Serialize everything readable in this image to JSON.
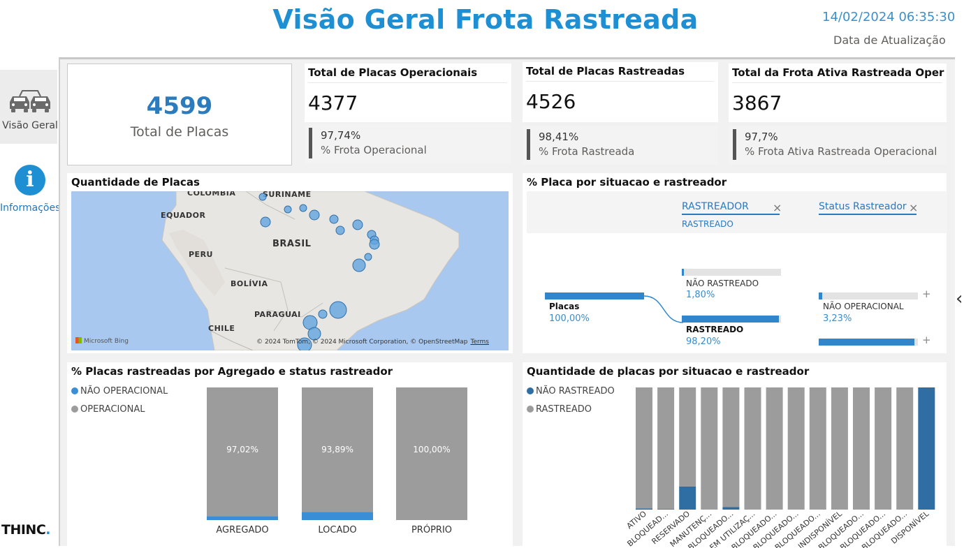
{
  "header": {
    "title": "Visão Geral Frota Rastreada",
    "update_datetime": "14/02/2024 06:35:30",
    "update_label": "Data de Atualização"
  },
  "sidebar": {
    "items": [
      {
        "label": "Visão Geral",
        "icon": "cars-icon",
        "active": true
      },
      {
        "label": "Informações",
        "icon": "info-icon",
        "active": false
      }
    ],
    "brand": "THINC."
  },
  "kpis": {
    "total": {
      "value": "4599",
      "label": "Total de Placas"
    },
    "operacionais": {
      "title": "Total de Placas Operacionais",
      "value": "4377",
      "pct": "97,74%",
      "pct_label": "% Frota Operacional"
    },
    "rastreadas": {
      "title": "Total de Placas Rastreadas",
      "value": "4526",
      "pct": "98,41%",
      "pct_label": "% Frota Rastreada"
    },
    "ativa": {
      "title": "Total da Frota Ativa Rastreada Operaci...",
      "value": "3867",
      "pct": "97,7%",
      "pct_label": "% Frota Ativa Rastreada Operacional"
    }
  },
  "map": {
    "title": "Quantidade de Placas",
    "labels": [
      "COLÔMBIA",
      "SURINAME",
      "EQUADOR",
      "BRASIL",
      "PERU",
      "BOLÍVIA",
      "PARAGUAI",
      "CHILE"
    ],
    "bing": "Microsoft Bing",
    "credit": "© 2024 TomTom, © 2024 Microsoft Corporation, © OpenStreetMap",
    "terms": "Terms"
  },
  "decomp": {
    "title": "% Placa por situacao e rastreador",
    "col1": "RASTREADOR",
    "col1_sub": "RASTREADO",
    "col2": "Status Rastreador",
    "root": {
      "label": "Placas",
      "value": "100,00%"
    },
    "level1": [
      {
        "label": "NÃO RASTREADO",
        "value": "1,80%",
        "pct": 1.8
      },
      {
        "label": "RASTREADO",
        "value": "98,20%",
        "pct": 98.2
      }
    ],
    "level2": [
      {
        "label": "NÃO OPERACIONAL",
        "value": "3,23%",
        "pct": 3.23
      },
      {
        "label": "OPERACIONAL",
        "value": "",
        "pct": 96.77
      }
    ]
  },
  "chart_agregado": {
    "title": "% Placas rastreadas por Agregado e status rastreador",
    "legend": [
      {
        "name": "NÃO OPERACIONAL",
        "color": "#3a8ed6"
      },
      {
        "name": "OPERACIONAL",
        "color": "#9c9c9c"
      }
    ]
  },
  "chart_situacao": {
    "title": "Quantidade de placas por situacao e rastreador",
    "legend": [
      {
        "name": "NÃO RASTREADO",
        "color": "#2e6ea2"
      },
      {
        "name": "RASTREADO",
        "color": "#9c9c9c"
      }
    ]
  },
  "chart_data": [
    {
      "type": "bar",
      "stacked": "100%",
      "categories": [
        "AGREGADO",
        "LOCADO",
        "PRÓPRIO"
      ],
      "series": [
        {
          "name": "NÃO OPERACIONAL",
          "values": [
            2.98,
            6.11,
            0.0
          ]
        },
        {
          "name": "OPERACIONAL",
          "values": [
            97.02,
            93.89,
            100.0
          ]
        }
      ],
      "data_labels": [
        "97,02%",
        "93,89%",
        "100,00%"
      ],
      "ylim": [
        0,
        100
      ],
      "legend": "top-left"
    },
    {
      "type": "bar",
      "stacked": "100%",
      "categories": [
        "ATIVO",
        "BLOQUEAD...",
        "RESERVADO",
        "MANUTENÇ...",
        "BLOQUEADO...",
        "EM UTILIZAÇ...",
        "BLOQUEADO...",
        "BLOQUEADO...",
        "BLOQUEADO...",
        "INDISPONÍVEL",
        "BLOQUEADO...",
        "BLOQUEADO...",
        "BLOQUEADO...",
        "DISPONÍVEL"
      ],
      "series": [
        {
          "name": "NÃO RASTREADO",
          "values": [
            1,
            0.5,
            19,
            0,
            2,
            0,
            0,
            0,
            0,
            0,
            0,
            0,
            0,
            100
          ]
        },
        {
          "name": "RASTREADO",
          "values": [
            99,
            99.5,
            81,
            100,
            98,
            100,
            100,
            100,
            100,
            100,
            100,
            100,
            100,
            0
          ]
        }
      ],
      "ylim": [
        0,
        100
      ],
      "legend": "top-left"
    }
  ]
}
